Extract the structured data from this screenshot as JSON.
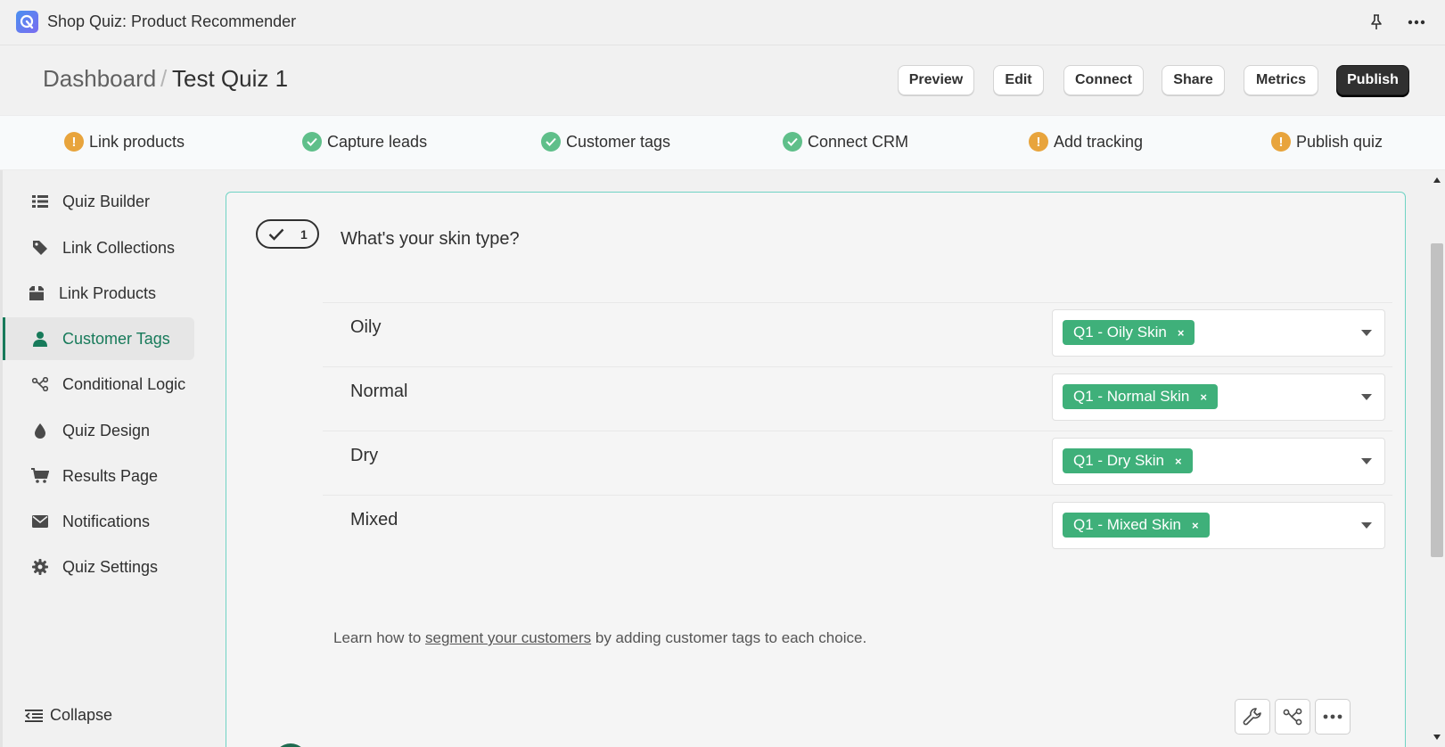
{
  "app": {
    "title": "Shop Quiz: Product Recommender",
    "logo_icon": "app-logo-icon"
  },
  "titlebar": {
    "pin_icon": "pin-icon",
    "more_icon": "more-horizontal-icon"
  },
  "breadcrumb": {
    "root": "Dashboard",
    "separator": "/",
    "current": "Test Quiz 1"
  },
  "header_buttons": [
    {
      "label": "Preview"
    },
    {
      "label": "Edit"
    },
    {
      "label": "Connect"
    },
    {
      "label": "Share"
    },
    {
      "label": "Metrics"
    },
    {
      "label": "Publish",
      "primary": true
    }
  ],
  "steps": [
    {
      "label": "Link products",
      "status": "warning"
    },
    {
      "label": "Capture leads",
      "status": "done"
    },
    {
      "label": "Customer tags",
      "status": "done"
    },
    {
      "label": "Connect CRM",
      "status": "done"
    },
    {
      "label": "Add tracking",
      "status": "warning"
    },
    {
      "label": "Publish quiz",
      "status": "warning"
    }
  ],
  "sidebar": {
    "items": [
      {
        "label": "Quiz Builder",
        "icon": "list-icon"
      },
      {
        "label": "Link Collections",
        "icon": "tag-icon"
      },
      {
        "label": "Link Products",
        "icon": "box-icon"
      },
      {
        "label": "Customer Tags",
        "icon": "person-icon",
        "active": true
      },
      {
        "label": "Conditional Logic",
        "icon": "branch-icon"
      },
      {
        "label": "Quiz Design",
        "icon": "droplet-icon"
      },
      {
        "label": "Results Page",
        "icon": "cart-icon"
      },
      {
        "label": "Notifications",
        "icon": "mail-icon"
      },
      {
        "label": "Quiz Settings",
        "icon": "gear-icon"
      }
    ],
    "collapse_label": "Collapse"
  },
  "question": {
    "number": "1",
    "title": "What's your skin type?",
    "choices": [
      {
        "label": "Oily",
        "tag": "Q1 - Oily Skin"
      },
      {
        "label": "Normal",
        "tag": "Q1 - Normal Skin"
      },
      {
        "label": "Dry",
        "tag": "Q1 - Dry Skin"
      },
      {
        "label": "Mixed",
        "tag": "Q1 - Mixed Skin"
      }
    ],
    "tag_remove": "×",
    "help": {
      "prefix": "Learn how to ",
      "link": "segment your customers",
      "suffix": " by adding customer tags to each choice."
    }
  },
  "colors": {
    "accent": "#177a5a",
    "tag_bg": "#3fb07a",
    "warning": "#e8a43c",
    "done": "#5fbf8a",
    "card_border": "#6fd3c4"
  }
}
